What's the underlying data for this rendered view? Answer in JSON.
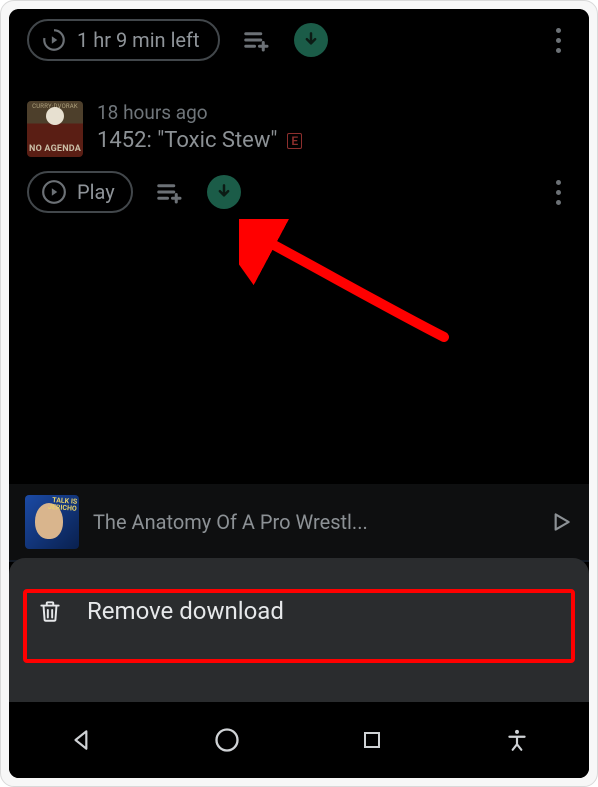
{
  "top_episode": {
    "time_left": "1 hr 9 min left"
  },
  "episode": {
    "ago": "18 hours ago",
    "title": "1452: \"Toxic Stew\"",
    "explicit": "E",
    "art_top": "CURRY·DVORAK",
    "art_bottom": "NO AGENDA",
    "play_label": "Play"
  },
  "mini_player": {
    "title": "The Anatomy Of A Pro Wrestl...",
    "art_label": "TALK IS JERICHO"
  },
  "sheet": {
    "remove_label": "Remove download"
  }
}
